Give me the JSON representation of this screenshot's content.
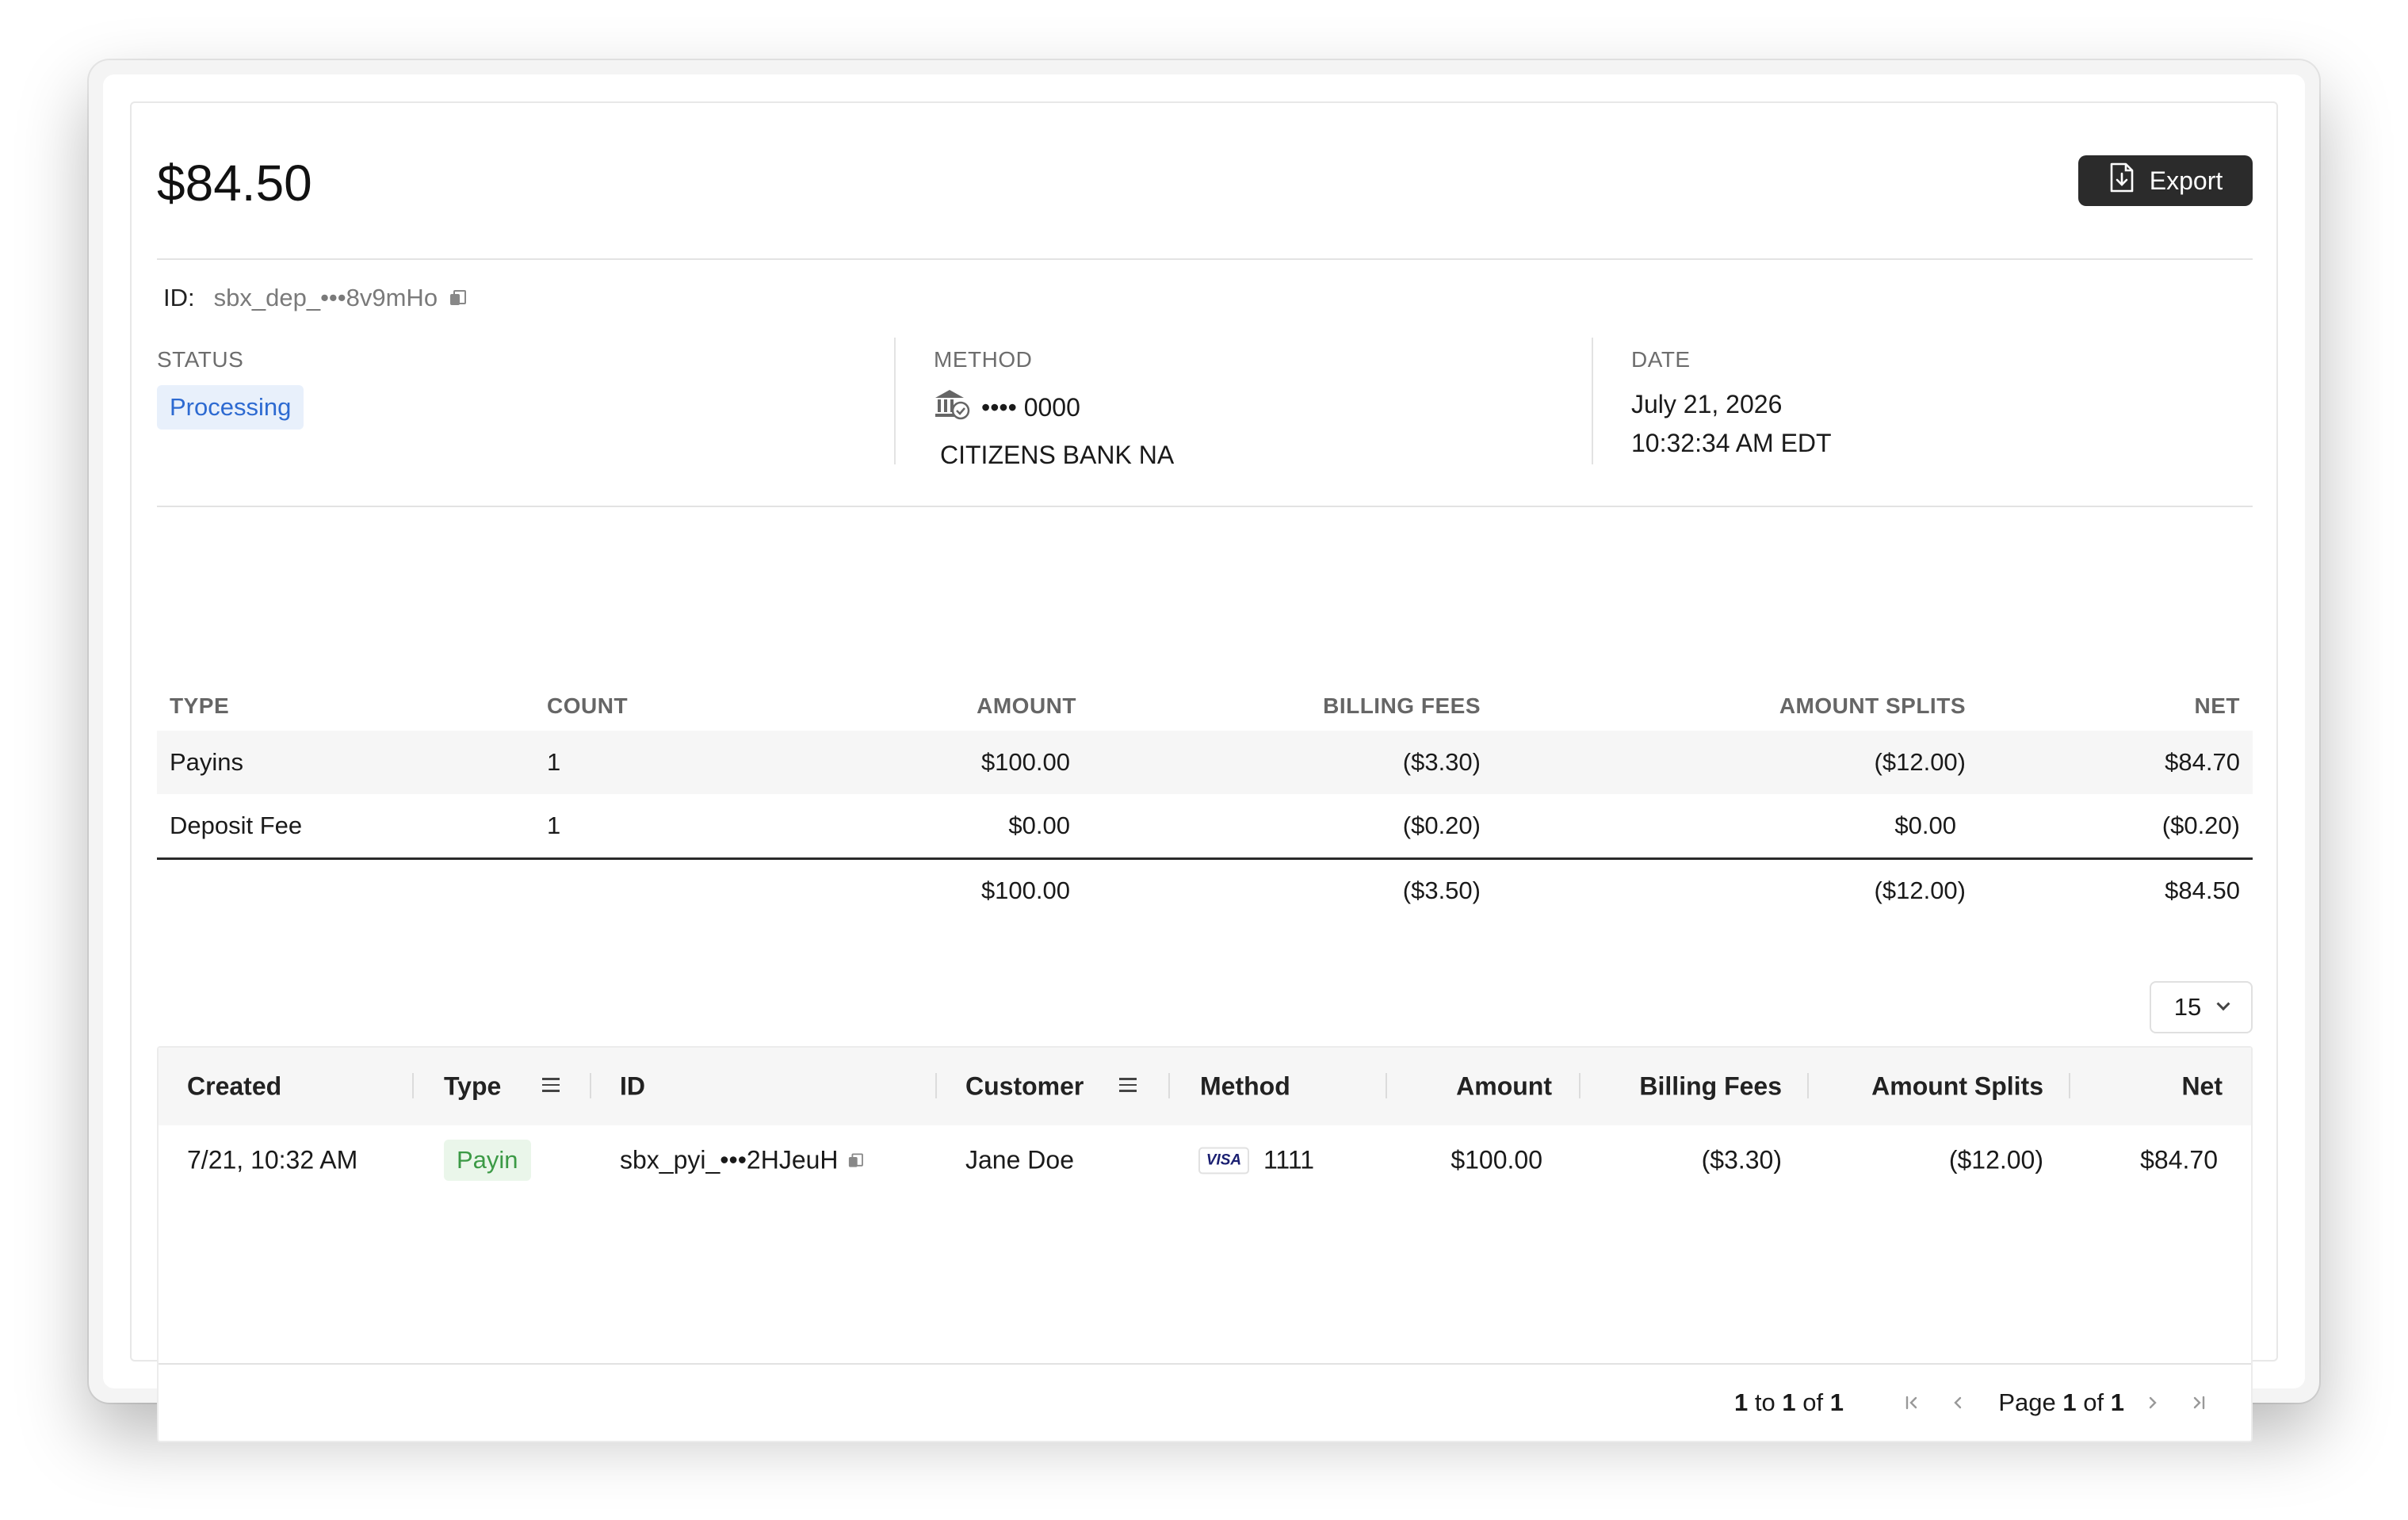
{
  "header": {
    "amount": "$84.50",
    "export_label": "Export"
  },
  "id_row": {
    "label": "ID:",
    "value": "sbx_dep_•••8v9mHo"
  },
  "meta": {
    "status_label": "STATUS",
    "status_value": "Processing",
    "method_label": "METHOD",
    "method_masked": "•••• 0000",
    "method_bank": "CITIZENS BANK NA",
    "date_label": "DATE",
    "date_value": "July 21, 2026",
    "time_value": "10:32:34 AM EDT"
  },
  "summary": {
    "headers": [
      "TYPE",
      "COUNT",
      "AMOUNT",
      "BILLING FEES",
      "AMOUNT SPLITS",
      "NET"
    ],
    "rows": [
      {
        "type": "Payins",
        "count": "1",
        "amount": "$100.00",
        "fees": "($3.30)",
        "splits": "($12.00)",
        "net": "$84.70"
      },
      {
        "type": "Deposit Fee",
        "count": "1",
        "amount": "$0.00",
        "fees": "($0.20)",
        "splits": "$0.00",
        "net": "($0.20)"
      }
    ],
    "total": {
      "amount": "$100.00",
      "fees": "($3.50)",
      "splits": "($12.00)",
      "net": "$84.50"
    }
  },
  "page_size": "15",
  "grid": {
    "headers": {
      "created": "Created",
      "type": "Type",
      "id": "ID",
      "customer": "Customer",
      "method": "Method",
      "amount": "Amount",
      "fees": "Billing Fees",
      "splits": "Amount Splits",
      "net": "Net"
    },
    "rows": [
      {
        "created": "7/21, 10:32 AM",
        "type": "Payin",
        "id": "sbx_pyi_•••2HJeuH",
        "customer": "Jane Doe",
        "card_brand": "VISA",
        "card_last4": "1111",
        "amount": "$100.00",
        "fees": "($3.30)",
        "splits": "($12.00)",
        "net": "$84.70"
      }
    ],
    "footer": {
      "range_start": "1",
      "range_to": "to",
      "range_end": "1",
      "range_of": "of",
      "range_total": "1",
      "page_word": "Page",
      "page_current": "1",
      "page_of": "of",
      "page_total": "1"
    }
  },
  "colors": {
    "export_bg": "#2b2b2b",
    "status_badge_bg": "#e8f0fb",
    "status_badge_text": "#2d6ad1",
    "payin_badge_bg": "#eaf6ea",
    "payin_badge_text": "#3c9a46"
  },
  "icons": [
    "file-export-icon",
    "copy-icon",
    "bank-icon",
    "filter-icon",
    "chevron-down-icon",
    "first-page-icon",
    "prev-page-icon",
    "next-page-icon",
    "last-page-icon",
    "visa-card-icon"
  ]
}
